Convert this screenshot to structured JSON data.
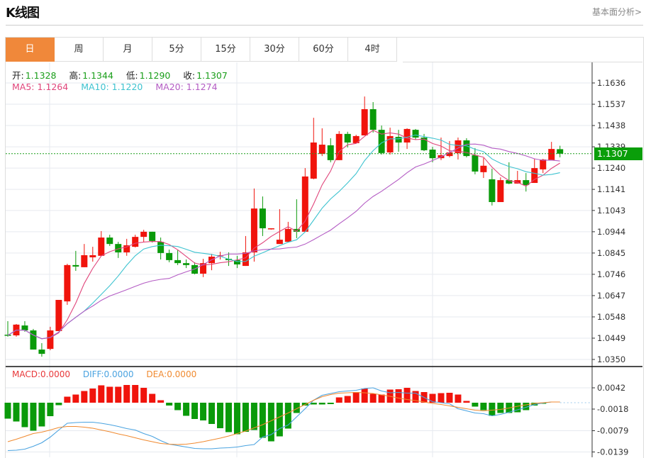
{
  "header": {
    "title": "K线图",
    "more_link": "基本面分析>"
  },
  "tabs": [
    {
      "label": "日",
      "active": true
    },
    {
      "label": "周"
    },
    {
      "label": "月"
    },
    {
      "label": "5分"
    },
    {
      "label": "15分"
    },
    {
      "label": "30分"
    },
    {
      "label": "60分"
    },
    {
      "label": "4时"
    }
  ],
  "quote": {
    "open_label": "开:",
    "open": "1.1328",
    "high_label": "高:",
    "high": "1.1344",
    "low_label": "低:",
    "low": "1.1290",
    "close_label": "收:",
    "close": "1.1307"
  },
  "ma": {
    "ma5_label": "MA5: 1.1264",
    "ma10_label": "MA10: 1.1220",
    "ma20_label": "MA20: 1.1274"
  },
  "macd_info": {
    "macd_label": "MACD:0.0000",
    "diff_label": "DIFF:0.0000",
    "dea_label": "DEA:0.0000"
  },
  "last_price": "1.1307",
  "colors": {
    "up": "#f0140c",
    "down": "#0a9a0a",
    "ma5": "#e0457b",
    "ma10": "#3ec3d0",
    "ma20": "#b45cc4",
    "diff": "#4aa3e0",
    "dea": "#f08a30",
    "value_green": "#1a9e1a",
    "active_tab": "#f0883a"
  },
  "chart_data": [
    {
      "type": "candlestick",
      "columns": [
        "open",
        "high",
        "low",
        "close"
      ],
      "candles": [
        [
          1.0465,
          1.0528,
          1.0456,
          1.0462
        ],
        [
          1.0462,
          1.0515,
          1.0456,
          1.0512
        ],
        [
          1.0508,
          1.0528,
          1.0479,
          1.0485
        ],
        [
          1.0485,
          1.0492,
          1.0396,
          1.0396
        ],
        [
          1.0396,
          1.0426,
          1.0363,
          1.0376
        ],
        [
          1.0399,
          1.0502,
          1.0393,
          1.0485
        ],
        [
          1.0482,
          1.0627,
          1.0482,
          1.0627
        ],
        [
          1.062,
          1.0795,
          1.0604,
          1.0789
        ],
        [
          1.0789,
          1.0855,
          1.0762,
          1.0782
        ],
        [
          1.0779,
          1.0887,
          1.0779,
          1.0835
        ],
        [
          1.0825,
          1.0874,
          1.0805,
          1.0835
        ],
        [
          1.0832,
          1.0947,
          1.0832,
          1.0917
        ],
        [
          1.0917,
          1.093,
          1.0878,
          1.0887
        ],
        [
          1.0887,
          1.0897,
          1.0822,
          1.0848
        ],
        [
          1.0848,
          1.0911,
          1.0832,
          1.0881
        ],
        [
          1.0874,
          1.093,
          1.0871,
          1.092
        ],
        [
          1.092,
          1.0953,
          1.0897,
          1.0944
        ],
        [
          1.0944,
          1.0944,
          1.0894,
          1.0901
        ],
        [
          1.0897,
          1.0917,
          1.0815,
          1.0845
        ],
        [
          1.0845,
          1.0861,
          1.0802,
          1.0812
        ],
        [
          1.0812,
          1.0858,
          1.0789,
          1.0798
        ],
        [
          1.0798,
          1.0815,
          1.0775,
          1.0789
        ],
        [
          1.0789,
          1.0802,
          1.0746,
          1.0749
        ],
        [
          1.0749,
          1.0818,
          1.0733,
          1.0798
        ],
        [
          1.0798,
          1.0841,
          1.0765,
          1.0828
        ],
        [
          1.0832,
          1.0851,
          1.0815,
          1.0835
        ],
        [
          1.0818,
          1.0848,
          1.0785,
          1.0812
        ],
        [
          1.0812,
          1.0832,
          1.0775,
          1.0792
        ],
        [
          1.0785,
          1.0924,
          1.0785,
          1.0848
        ],
        [
          1.0848,
          1.1145,
          1.0805,
          1.1052
        ],
        [
          1.1052,
          1.1108,
          1.0924,
          1.096
        ],
        [
          1.0957,
          1.096,
          1.0954,
          1.096
        ],
        [
          1.0887,
          1.1049,
          1.0887,
          1.0907
        ],
        [
          1.0897,
          1.099,
          1.0894,
          1.0957
        ],
        [
          1.0957,
          1.1095,
          1.0914,
          1.0944
        ],
        [
          1.0944,
          1.124,
          1.0944,
          1.1201
        ],
        [
          1.1191,
          1.1474,
          1.1188,
          1.1359
        ],
        [
          1.1306,
          1.1425,
          1.1296,
          1.1349
        ],
        [
          1.1346,
          1.1379,
          1.1267,
          1.1277
        ],
        [
          1.1277,
          1.1412,
          1.1277,
          1.1399
        ],
        [
          1.1399,
          1.1409,
          1.1336,
          1.1359
        ],
        [
          1.1356,
          1.1395,
          1.1356,
          1.1389
        ],
        [
          1.1392,
          1.1573,
          1.1392,
          1.1514
        ],
        [
          1.1514,
          1.1547,
          1.1405,
          1.1418
        ],
        [
          1.1418,
          1.1438,
          1.1303,
          1.131
        ],
        [
          1.1313,
          1.1428,
          1.1303,
          1.1389
        ],
        [
          1.1385,
          1.1418,
          1.1316,
          1.1359
        ],
        [
          1.1359,
          1.1425,
          1.1329,
          1.1422
        ],
        [
          1.1418,
          1.1422,
          1.1372,
          1.1382
        ],
        [
          1.1382,
          1.1399,
          1.1319,
          1.1323
        ],
        [
          1.1326,
          1.1339,
          1.1267,
          1.1286
        ],
        [
          1.1286,
          1.1382,
          1.1277,
          1.13
        ],
        [
          1.1296,
          1.1366,
          1.129,
          1.1313
        ],
        [
          1.131,
          1.1382,
          1.128,
          1.1369
        ],
        [
          1.1369,
          1.1379,
          1.129,
          1.1296
        ],
        [
          1.13,
          1.1333,
          1.1211,
          1.1224
        ],
        [
          1.1221,
          1.1287,
          1.1194,
          1.1251
        ],
        [
          1.1188,
          1.1237,
          1.1066,
          1.1082
        ],
        [
          1.1082,
          1.1197,
          1.1082,
          1.1184
        ],
        [
          1.1184,
          1.1267,
          1.1165,
          1.1168
        ],
        [
          1.1168,
          1.1227,
          1.1168,
          1.1184
        ],
        [
          1.1184,
          1.1217,
          1.1131,
          1.1161
        ],
        [
          1.1171,
          1.1283,
          1.1171,
          1.124
        ],
        [
          1.1234,
          1.1283,
          1.1217,
          1.128
        ],
        [
          1.1277,
          1.1362,
          1.1277,
          1.1329
        ],
        [
          1.1328,
          1.1344,
          1.129,
          1.1307
        ]
      ],
      "moving_averages": [
        5,
        10,
        20
      ],
      "yticks": [
        "1.1636",
        "1.1537",
        "1.1438",
        "1.1339",
        "1.1240",
        "1.1141",
        "1.1043",
        "1.0944",
        "1.0845",
        "1.0746",
        "1.0647",
        "1.0548",
        "1.0449",
        "1.0350"
      ],
      "ylim": [
        1.035,
        1.1636
      ],
      "grid": true
    },
    {
      "type": "bar+line",
      "histogram": [
        -0.0045,
        -0.0053,
        -0.0069,
        -0.0079,
        -0.0067,
        -0.0038,
        -0.0007,
        0.0017,
        0.0023,
        0.0033,
        0.004,
        0.0049,
        0.0045,
        0.0045,
        0.005,
        0.005,
        0.0042,
        0.0025,
        0.0007,
        -0.0008,
        -0.0021,
        -0.0037,
        -0.0046,
        -0.005,
        -0.006,
        -0.0072,
        -0.0083,
        -0.0089,
        -0.0082,
        -0.0077,
        -0.0099,
        -0.0109,
        -0.0095,
        -0.0073,
        -0.0029,
        -0.0008,
        -0.0005,
        -0.0005,
        -0.0004,
        0.0015,
        0.0019,
        0.003,
        0.004,
        0.0025,
        0.0023,
        0.0037,
        0.0038,
        0.0042,
        0.0033,
        0.003,
        0.0025,
        0.0027,
        0.0028,
        0.0023,
        0.0005,
        -0.0011,
        -0.0021,
        -0.0037,
        -0.0029,
        -0.0029,
        -0.0027,
        -0.0021,
        -0.0008,
        -0.0003,
        0,
        0
      ],
      "diff": [
        -0.0135,
        -0.0134,
        -0.0131,
        -0.0123,
        -0.0113,
        -0.0097,
        -0.0077,
        -0.0058,
        -0.0056,
        -0.0055,
        -0.0055,
        -0.0058,
        -0.0062,
        -0.0067,
        -0.0073,
        -0.0077,
        -0.0087,
        -0.0095,
        -0.0107,
        -0.0117,
        -0.0121,
        -0.0125,
        -0.0129,
        -0.013,
        -0.013,
        -0.0128,
        -0.0127,
        -0.0125,
        -0.0121,
        -0.0118,
        -0.0097,
        -0.009,
        -0.0073,
        -0.0063,
        -0.004,
        -0.0017,
        0.0007,
        0.0021,
        0.0026,
        0.0031,
        0.0033,
        0.0035,
        0.004,
        0.0042,
        0.0033,
        0.0028,
        0.0029,
        0.0027,
        0.0027,
        0.0015,
        0.0003,
        0.0,
        -0.0003,
        -0.0017,
        -0.0023,
        -0.0029,
        -0.0031,
        -0.0037,
        -0.0033,
        -0.0027,
        -0.002,
        -0.0013,
        -0.0005,
        -0.0001,
        0.0002,
        0.0002
      ],
      "dea": [
        -0.011,
        -0.0103,
        -0.0095,
        -0.0087,
        -0.0083,
        -0.0077,
        -0.007,
        -0.0067,
        -0.0067,
        -0.0069,
        -0.0072,
        -0.0077,
        -0.0082,
        -0.0088,
        -0.0093,
        -0.0099,
        -0.0105,
        -0.011,
        -0.0115,
        -0.0117,
        -0.0118,
        -0.0117,
        -0.0114,
        -0.011,
        -0.0105,
        -0.01,
        -0.0094,
        -0.0087,
        -0.008,
        -0.0071,
        -0.0062,
        -0.0051,
        -0.004,
        -0.0029,
        -0.0017,
        -0.0005,
        0.0007,
        0.0017,
        0.0023,
        0.0027,
        0.0028,
        0.0029,
        0.0028,
        0.0026,
        0.0022,
        0.0018,
        0.0013,
        0.0009,
        0.0006,
        0.0002,
        -0.0002,
        -0.0005,
        -0.0009,
        -0.0013,
        -0.0017,
        -0.0021,
        -0.0023,
        -0.0021,
        -0.0019,
        -0.0015,
        -0.001,
        -0.0006,
        -0.0002,
        0.0,
        0.0002,
        0.0002
      ],
      "yticks": [
        "0.0042",
        "-0.0018",
        "-0.0079",
        "-0.0139"
      ]
    }
  ]
}
